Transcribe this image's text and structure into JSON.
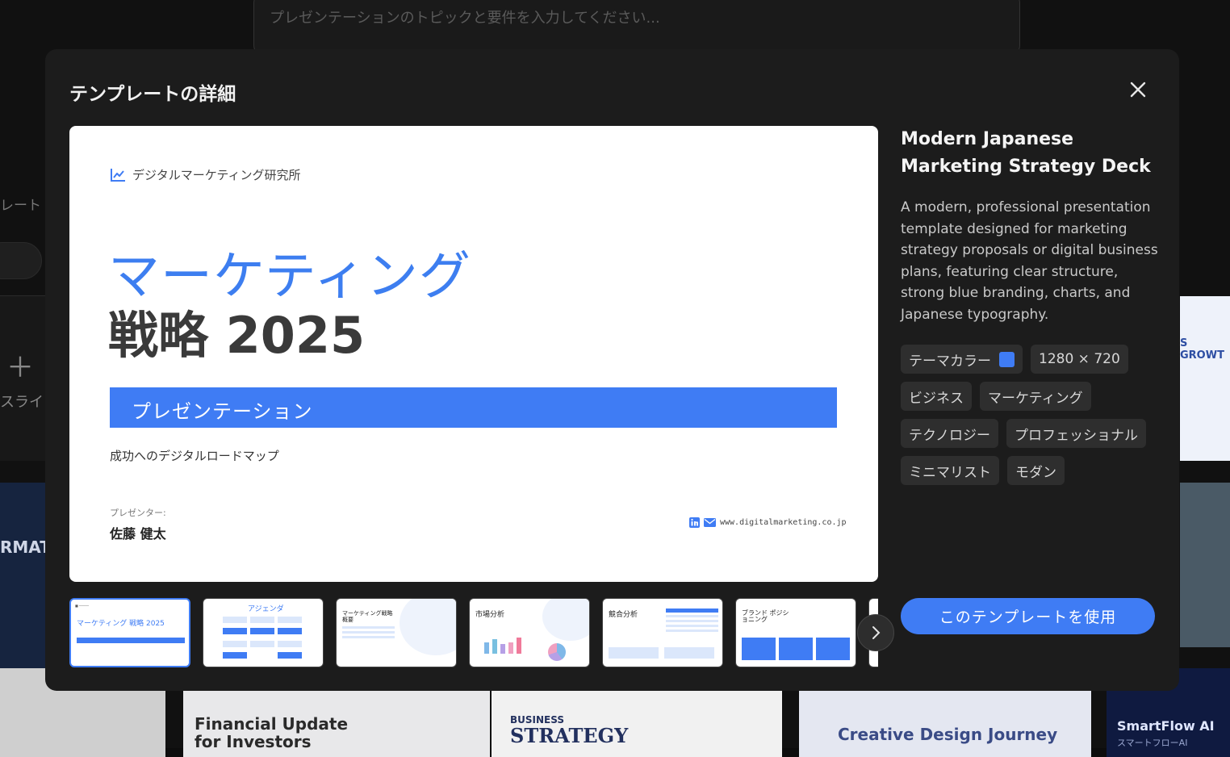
{
  "background": {
    "prompt_placeholder": "プレゼンテーションのトピックと要件を入力してください...",
    "side_label": "レート",
    "slide_label": "スライド",
    "left_card_text": "RMAT",
    "right_card_text": "S GROWT",
    "bottom_cards": [
      {
        "text": "Financial Update for Investors"
      },
      {
        "text_small": "BUSINESS",
        "text": "STRATEGY"
      },
      {
        "text": "Creative Design Journey"
      },
      {
        "text": "SmartFlow AI",
        "sub": "スマートフローAI"
      }
    ]
  },
  "modal": {
    "title": "テンプレートの詳細",
    "close_icon": "close-icon"
  },
  "preview": {
    "org": "デジタルマーケティング研究所",
    "title_line1": "マーケティング",
    "title_line2": "戦略  2025",
    "band": "プレゼンテーション",
    "subtitle": "成功へのデジタルロードマップ",
    "presenter_label": "プレゼンター:",
    "presenter": "佐藤  健太",
    "website": "www.digitalmarketing.co.jp"
  },
  "thumbnails": [
    {
      "title": "マーケティング 戦略 2025"
    },
    {
      "title": "アジェンダ"
    },
    {
      "title": "マーケティング戦略 概要"
    },
    {
      "title": "市場分析"
    },
    {
      "title": "競合分析"
    },
    {
      "title": "ブランド ポジショニング"
    }
  ],
  "info": {
    "title": "Modern Japanese Marketing Strategy Deck",
    "description": "A modern, professional presentation template designed for marketing strategy proposals or digital business plans, featuring clear structure, strong blue branding, charts, and Japanese typography.",
    "theme_color_label": "テーマカラー",
    "theme_color": "#3f7cf4",
    "size": "1280 × 720",
    "tags": [
      "ビジネス",
      "マーケティング",
      "テクノロジー",
      "プロフェッショナル",
      "ミニマリスト",
      "モダン"
    ],
    "use_button": "このテンプレートを使用"
  }
}
